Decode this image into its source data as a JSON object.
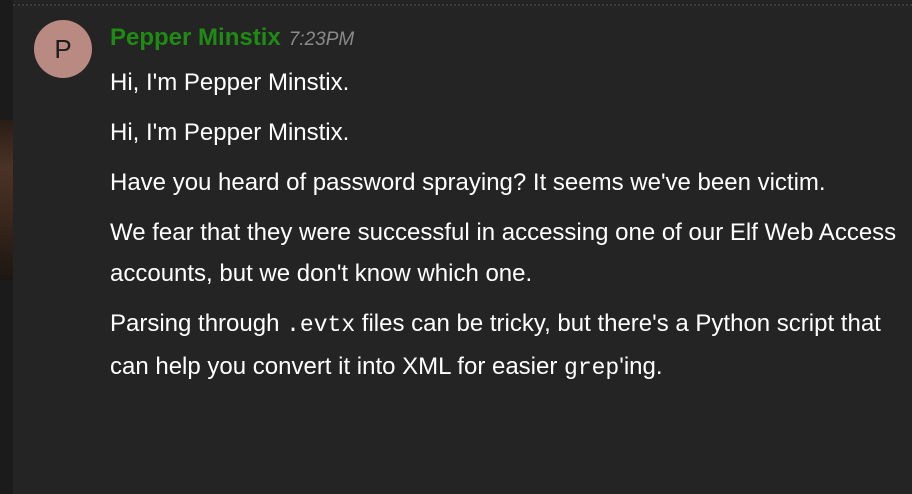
{
  "message": {
    "avatar_letter": "P",
    "author": "Pepper Minstix",
    "timestamp": "7:23PM",
    "lines": [
      "Hi, I'm Pepper Minstix.",
      "Hi, I'm Pepper Minstix.",
      "Have you heard of password spraying? It seems we've been victim.",
      "We fear that they were successful in accessing one of our Elf Web Access accounts, but we don't know which one."
    ],
    "last": {
      "before_code": "Parsing through ",
      "code_1": ".evtx",
      "middle": " files can be tricky, but there's a Python script that can help you convert it into XML for easier ",
      "code_2": "grep",
      "after_code": "'ing."
    }
  },
  "colors": {
    "background": "#242424",
    "author": "#1f8b14",
    "timestamp": "#8a8a8a",
    "text": "#ffffff",
    "avatar": "#b98a81"
  }
}
